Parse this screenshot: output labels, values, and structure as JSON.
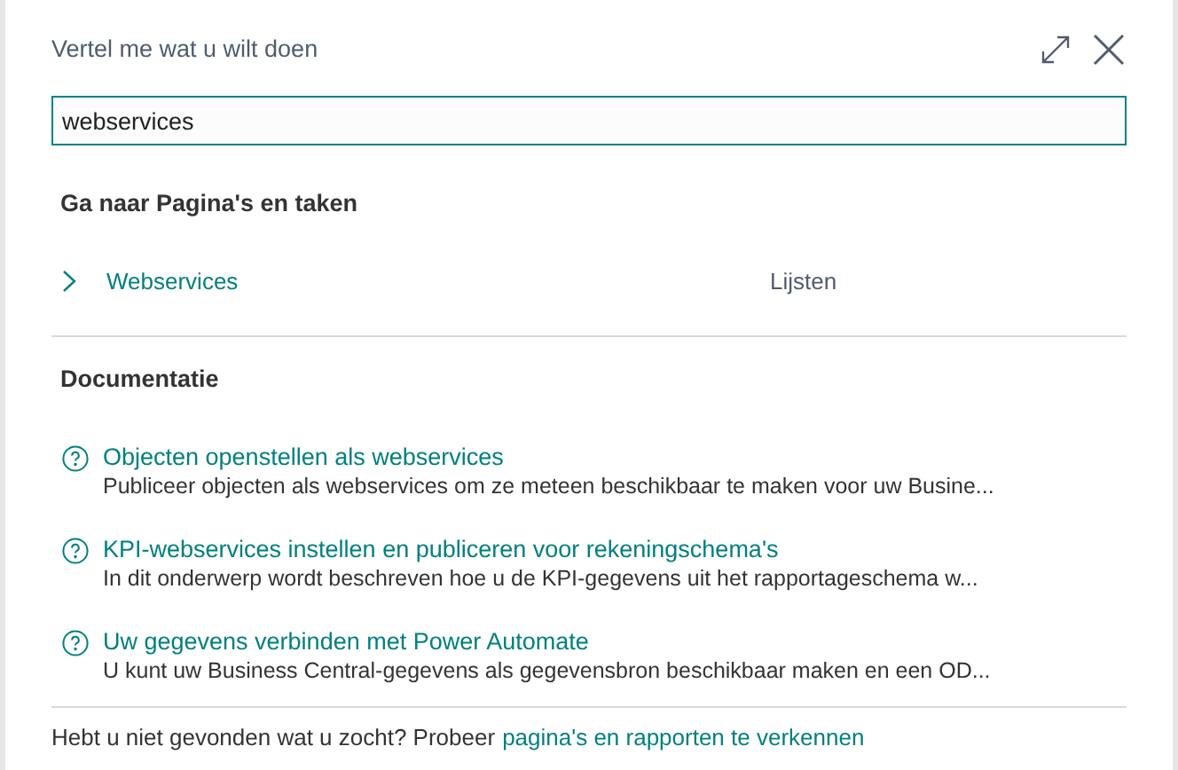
{
  "dialog": {
    "title": "Vertel me wat u wilt doen"
  },
  "search": {
    "value": "webservices"
  },
  "pages_section": {
    "heading": "Ga naar Pagina's en taken",
    "results": [
      {
        "name": "Webservices",
        "category": "Lijsten"
      }
    ]
  },
  "docs_section": {
    "heading": "Documentatie",
    "results": [
      {
        "title": "Objecten openstellen als webservices",
        "description": "Publiceer objecten als webservices om ze meteen beschikbaar te maken voor uw Busine..."
      },
      {
        "title": "KPI-webservices instellen en publiceren voor rekeningschema's",
        "description": "In dit onderwerp wordt beschreven hoe u de KPI-gegevens uit het rapportageschema w..."
      },
      {
        "title": "Uw gegevens verbinden met Power Automate",
        "description": "U kunt uw Business Central-gegevens als gegevensbron beschikbaar maken en een OD..."
      }
    ]
  },
  "footer": {
    "text": "Hebt u niet gevonden wat u zocht? Probeer",
    "link": "pagina's en rapporten te verkennen"
  }
}
